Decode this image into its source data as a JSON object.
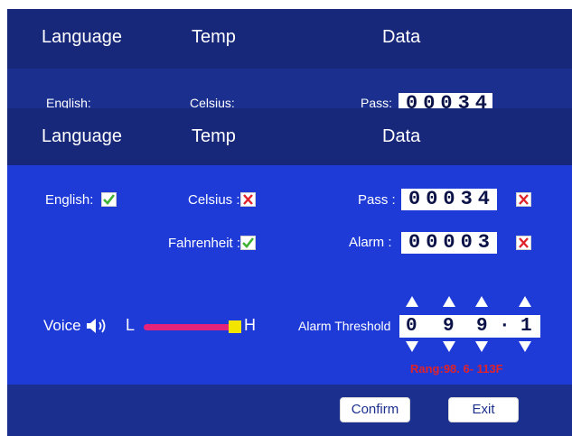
{
  "ghost_panel": {
    "header": {
      "language": "Language",
      "temp": "Temp",
      "data": "Data"
    },
    "partial": {
      "english_label": "English:",
      "celsius_label": "Celsius:",
      "pass_label": "Pass:",
      "pass_value": "00034"
    }
  },
  "header": {
    "language": "Language",
    "temp": "Temp",
    "data": "Data"
  },
  "language": {
    "english_label": "English:",
    "english_checked": true
  },
  "temp": {
    "celsius_label": "Celsius :",
    "celsius_checked": false,
    "fahrenheit_label": "Fahrenheit :",
    "fahrenheit_checked": true
  },
  "data": {
    "pass_label": "Pass :",
    "pass_value": "00034",
    "alarm_label": "Alarm :",
    "alarm_value": "00003"
  },
  "voice": {
    "label": "Voice",
    "low_label": "L",
    "high_label": "H",
    "level": 1.0
  },
  "alarm_threshold": {
    "label": "Alarm Threshold",
    "digits": [
      "0",
      "9",
      "9",
      "·",
      "1"
    ],
    "range_text": "Rang:98. 6- 113F"
  },
  "buttons": {
    "confirm": "Confirm",
    "exit": "Exit"
  },
  "colors": {
    "header_bg": "#17277a",
    "body_bg": "#1e3bd8",
    "footer_bg": "#1b2f8e",
    "slider_track": "#e5237a",
    "slider_thumb": "#f2e600",
    "range_text": "#e0232b",
    "check_green": "#3fb236",
    "cross_red": "#e0232b"
  },
  "icons": {
    "check": "check-icon",
    "cross": "cross-icon",
    "speaker": "speaker-icon",
    "arrow_up": "arrow-up-icon",
    "arrow_down": "arrow-down-icon"
  }
}
